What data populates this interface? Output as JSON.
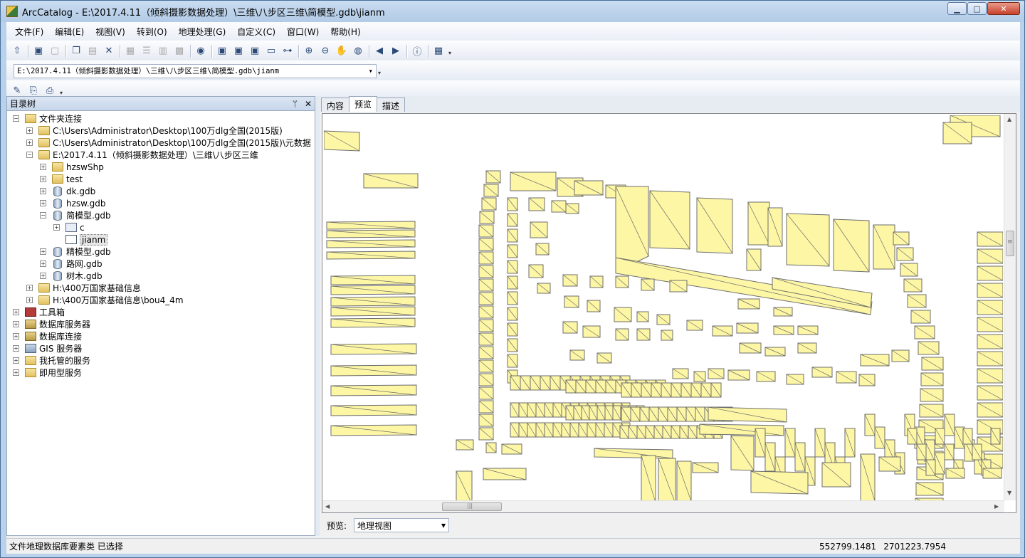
{
  "window": {
    "title": "ArcCatalog - E:\\2017.4.11（倾斜摄影数据处理）\\三维\\八步区三维\\简模型.gdb\\jianm",
    "controls": {
      "minimize": "▁",
      "maximize": "□",
      "close": "✕"
    }
  },
  "menu": [
    "文件(F)",
    "编辑(E)",
    "视图(V)",
    "转到(O)",
    "地理处理(G)",
    "自定义(C)",
    "窗口(W)",
    "帮助(H)"
  ],
  "toolbar": {
    "buttons": [
      {
        "name": "up-level-icon",
        "glyph": "⇧",
        "enabled": true
      },
      {
        "name": "connect-folder-icon",
        "glyph": "▣",
        "enabled": true
      },
      {
        "name": "disconnect-folder-icon",
        "glyph": "▢",
        "enabled": false
      },
      {
        "name": "copy-icon",
        "glyph": "❐",
        "enabled": true
      },
      {
        "name": "paste-icon",
        "glyph": "▤",
        "enabled": false
      },
      {
        "name": "delete-icon",
        "glyph": "✕",
        "enabled": true
      },
      {
        "name": "large-icons-icon",
        "glyph": "▦",
        "enabled": false
      },
      {
        "name": "list-icon",
        "glyph": "☰",
        "enabled": false
      },
      {
        "name": "details-icon",
        "glyph": "▥",
        "enabled": false
      },
      {
        "name": "thumbnails-icon",
        "glyph": "▩",
        "enabled": false
      },
      {
        "name": "launch-arcmap-icon",
        "glyph": "◉",
        "enabled": true
      },
      {
        "name": "catalog-window-icon",
        "glyph": "▣",
        "enabled": true
      },
      {
        "name": "search-window-icon",
        "glyph": "▣",
        "enabled": true
      },
      {
        "name": "arctoolbox-icon",
        "glyph": "▣",
        "enabled": true
      },
      {
        "name": "python-window-icon",
        "glyph": "▭",
        "enabled": true
      },
      {
        "name": "model-builder-icon",
        "glyph": "⊶",
        "enabled": true
      },
      {
        "name": "zoom-in-icon",
        "glyph": "⊕",
        "enabled": true
      },
      {
        "name": "zoom-out-icon",
        "glyph": "⊖",
        "enabled": true
      },
      {
        "name": "pan-icon",
        "glyph": "✋",
        "enabled": true
      },
      {
        "name": "full-extent-icon",
        "glyph": "◍",
        "enabled": true
      },
      {
        "name": "back-icon",
        "glyph": "◀",
        "enabled": true
      },
      {
        "name": "forward-icon",
        "glyph": "▶",
        "enabled": true
      },
      {
        "name": "identify-icon",
        "glyph": "ⓘ",
        "enabled": true
      },
      {
        "name": "create-thumbnail-icon",
        "glyph": "▦",
        "enabled": true
      }
    ]
  },
  "location": {
    "value": "E:\\2017.4.11（倾斜摄影数据处理）\\三维\\八步区三维\\简模型.gdb\\jianm"
  },
  "metadata_toolbar": [
    {
      "name": "edit-metadata-icon",
      "glyph": "✎"
    },
    {
      "name": "import-metadata-icon",
      "glyph": "⎘"
    },
    {
      "name": "export-metadata-icon",
      "glyph": "⎙"
    }
  ],
  "tree_panel": {
    "title": "目录树",
    "pin": "ᛘ",
    "close": "✕",
    "items": [
      {
        "label": "文件夹连接",
        "level": 0,
        "exp": "−",
        "icon": "folder-conn"
      },
      {
        "label": "C:\\Users\\Administrator\\Desktop\\100万dlg全国(2015版)",
        "level": 1,
        "exp": "+",
        "icon": "folder"
      },
      {
        "label": "C:\\Users\\Administrator\\Desktop\\100万dlg全国(2015版)\\元数据",
        "level": 1,
        "exp": "+",
        "icon": "folder"
      },
      {
        "label": "E:\\2017.4.11（倾斜摄影数据处理）\\三维\\八步区三维",
        "level": 1,
        "exp": "−",
        "icon": "folder"
      },
      {
        "label": "hzswShp",
        "level": 2,
        "exp": "+",
        "icon": "folder"
      },
      {
        "label": "test",
        "level": 2,
        "exp": "+",
        "icon": "folder"
      },
      {
        "label": "dk.gdb",
        "level": 2,
        "exp": "+",
        "icon": "gdb"
      },
      {
        "label": "hzsw.gdb",
        "level": 2,
        "exp": "+",
        "icon": "gdb"
      },
      {
        "label": "简模型.gdb",
        "level": 2,
        "exp": "−",
        "icon": "gdb"
      },
      {
        "label": "c",
        "level": 3,
        "exp": "+",
        "icon": "dataset"
      },
      {
        "label": "jianm",
        "level": 3,
        "exp": "",
        "icon": "fc",
        "selected": true
      },
      {
        "label": "精模型.gdb",
        "level": 2,
        "exp": "+",
        "icon": "gdb"
      },
      {
        "label": "路网.gdb",
        "level": 2,
        "exp": "+",
        "icon": "gdb"
      },
      {
        "label": "树木.gdb",
        "level": 2,
        "exp": "+",
        "icon": "gdb"
      },
      {
        "label": "H:\\400万国家基础信息",
        "level": 1,
        "exp": "+",
        "icon": "folder"
      },
      {
        "label": "H:\\400万国家基础信息\\bou4_4m",
        "level": 1,
        "exp": "+",
        "icon": "folder"
      },
      {
        "label": "工具箱",
        "level": 0,
        "exp": "+",
        "icon": "toolbox"
      },
      {
        "label": "数据库服务器",
        "level": 0,
        "exp": "+",
        "icon": "db-server"
      },
      {
        "label": "数据库连接",
        "level": 0,
        "exp": "+",
        "icon": "db-server"
      },
      {
        "label": "GIS 服务器",
        "level": 0,
        "exp": "+",
        "icon": "gis"
      },
      {
        "label": "我托管的服务",
        "level": 0,
        "exp": "+",
        "icon": "folder-conn"
      },
      {
        "label": "即用型服务",
        "level": 0,
        "exp": "+",
        "icon": "folder-conn"
      }
    ]
  },
  "tabs": [
    {
      "label": "内容",
      "active": false
    },
    {
      "label": "预览",
      "active": true
    },
    {
      "label": "描述",
      "active": false
    }
  ],
  "preview": {
    "label": "预览:",
    "type_value": "地理视图",
    "dropdown_arrow": "▾",
    "scroll": {
      "up": "▲",
      "down": "▼",
      "left": "◀",
      "right": "▶",
      "grip": "|||",
      "vgrip": "≡"
    },
    "colors": {
      "fill": "#fdf7a5",
      "stroke": "#6e6e6e"
    }
  },
  "status": {
    "left": "文件地理数据库要素类 已选择",
    "x": "552799.1481",
    "y": "2701223.7954"
  }
}
